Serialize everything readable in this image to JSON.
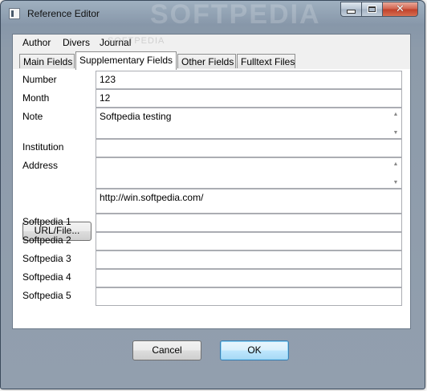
{
  "window": {
    "title": "Reference Editor",
    "watermark": "SOFTPEDIA",
    "menu_watermark": "SOFTPEDIA"
  },
  "menu": [
    "Author",
    "Divers",
    "Journal"
  ],
  "tabs": [
    {
      "label": "Main Fields",
      "active": false
    },
    {
      "label": "Supplementary Fields",
      "active": true
    },
    {
      "label": "Other Fields",
      "active": false
    },
    {
      "label": "Fulltext Files",
      "active": false
    }
  ],
  "fields": {
    "number": {
      "label": "Number",
      "value": "123"
    },
    "month": {
      "label": "Month",
      "value": "12"
    },
    "note": {
      "label": "Note",
      "value": "Softpedia testing"
    },
    "institution": {
      "label": "Institution",
      "value": ""
    },
    "address": {
      "label": "Address",
      "value": ""
    },
    "url": {
      "button_label": "URL/File...",
      "value": "http://win.softpedia.com/"
    },
    "custom": [
      {
        "label": "Softpedia 1",
        "value": ""
      },
      {
        "label": "Softpedia 2",
        "value": ""
      },
      {
        "label": "Softpedia 3",
        "value": ""
      },
      {
        "label": "Softpedia 4",
        "value": ""
      },
      {
        "label": "Softpedia 5",
        "value": ""
      }
    ]
  },
  "buttons": {
    "cancel": "Cancel",
    "ok": "OK"
  },
  "colors": {
    "frame": "#8d9baa",
    "default_button": "#bee6fd",
    "close_button": "#c0402a"
  }
}
